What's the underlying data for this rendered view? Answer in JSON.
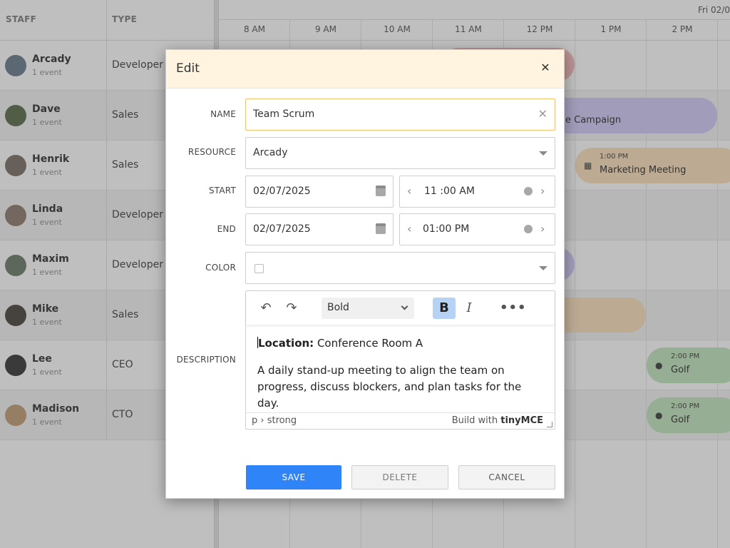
{
  "scheduler": {
    "col_staff": "STAFF",
    "col_type": "TYPE",
    "date_label": "Fri 02/0",
    "hours": [
      "8 AM",
      "9 AM",
      "10 AM",
      "11 AM",
      "12 PM",
      "1 PM",
      "2 PM"
    ],
    "staff": [
      {
        "name": "Arcady",
        "sub": "1 event",
        "type": "Developer"
      },
      {
        "name": "Dave",
        "sub": "1 event",
        "type": "Sales"
      },
      {
        "name": "Henrik",
        "sub": "1 event",
        "type": "Sales"
      },
      {
        "name": "Linda",
        "sub": "1 event",
        "type": "Developer"
      },
      {
        "name": "Maxim",
        "sub": "1 event",
        "type": "Developer"
      },
      {
        "name": "Mike",
        "sub": "1 event",
        "type": "Sales"
      },
      {
        "name": "Lee",
        "sub": "1 event",
        "type": "CEO"
      },
      {
        "name": "Madison",
        "sub": "1 event",
        "type": "CTO"
      }
    ],
    "events": {
      "dave": {
        "title": "e Campaign"
      },
      "henrik": {
        "time": "1:00 PM",
        "title": "Marketing Meeting"
      },
      "lee": {
        "time": "2:00 PM",
        "title": "Golf"
      },
      "madison": {
        "time": "2:00 PM",
        "title": "Golf"
      }
    },
    "colors": {
      "purple": "#d6d0f7",
      "orange": "#fbe3c4",
      "green": "#c9e8c4",
      "red": "#f7c3c3"
    }
  },
  "modal": {
    "title": "Edit",
    "labels": {
      "name": "NAME",
      "resource": "RESOURCE",
      "start": "START",
      "end": "END",
      "color": "COLOR",
      "description": "DESCRIPTION"
    },
    "name_value": "Team Scrum",
    "resource_value": "Arcady",
    "start_date": "02/07/2025",
    "start_time": "11 :00 AM",
    "end_date": "02/07/2025",
    "end_time": "01:00 PM",
    "editor": {
      "format_select": "Bold",
      "location_label": "Location:",
      "location_value": " Conference Room A",
      "paragraph": "A daily stand-up meeting to align the team on progress, discuss blockers, and plan tasks for the day.",
      "path": "p › strong",
      "brand_prefix": "Build with",
      "brand_name": "tinyMCE"
    },
    "buttons": {
      "save": "SAVE",
      "delete": "DELETE",
      "cancel": "CANCEL"
    }
  }
}
